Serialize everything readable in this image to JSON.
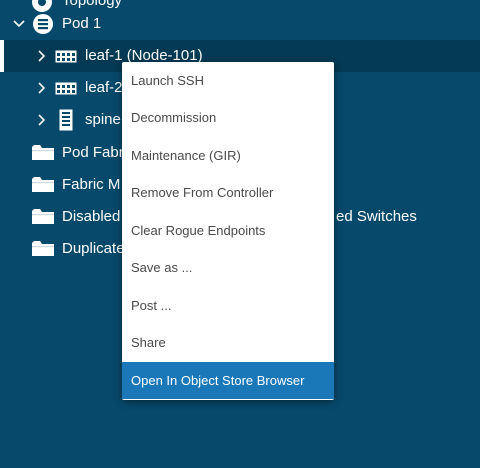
{
  "tree": {
    "top_partial_label": "Topology",
    "pod": {
      "label": "Pod 1"
    },
    "nodes": [
      {
        "label": "leaf-1 (Node-101)"
      },
      {
        "label": "leaf-2"
      },
      {
        "label": "spine"
      }
    ],
    "folders": [
      {
        "label": "Pod Fabric"
      },
      {
        "label": "Fabric M"
      },
      {
        "label": "Disabled",
        "tail": "ed Switches"
      },
      {
        "label": "Duplicate"
      }
    ]
  },
  "context_menu": {
    "items": [
      {
        "label": "Launch SSH"
      },
      {
        "label": "Decommission"
      },
      {
        "label": "Maintenance (GIR)"
      },
      {
        "label": "Remove From Controller"
      },
      {
        "label": "Clear Rogue Endpoints"
      },
      {
        "label": "Save as ..."
      },
      {
        "label": "Post ..."
      },
      {
        "label": "Share"
      },
      {
        "label": "Open In Object Store Browser"
      }
    ]
  },
  "colors": {
    "background": "#07496b",
    "selected_row": "#053a55",
    "menu_highlight": "#1a78b8"
  }
}
